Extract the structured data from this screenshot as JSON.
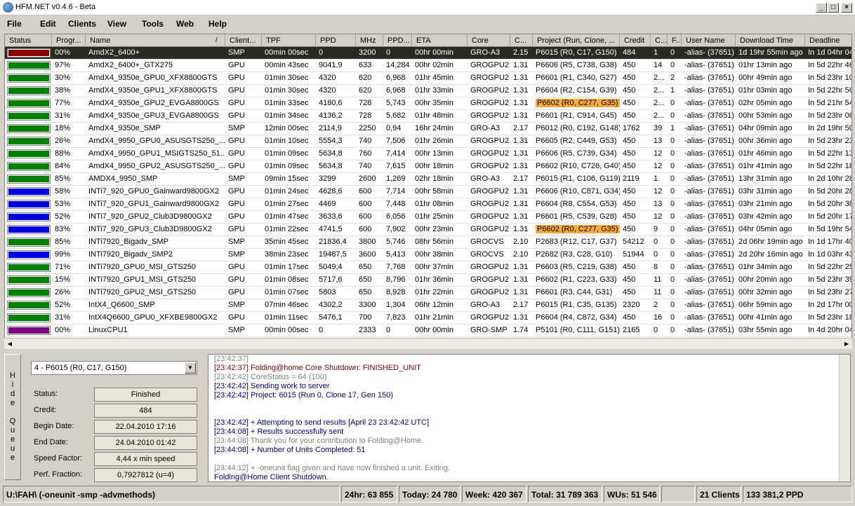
{
  "window": {
    "title": "HFM.NET v0.4.6 - Beta",
    "min": "_",
    "max": "□",
    "close": "×"
  },
  "menu": [
    "File",
    "Edit",
    "Clients",
    "View",
    "Tools",
    "Web",
    "Help"
  ],
  "columns": [
    "Status",
    "Progr...",
    "Name",
    "Client...",
    "TPF",
    "PPD",
    "MHz",
    "PPD...",
    "ETA",
    "Core",
    "C...",
    "Project (Run, Clone, ...",
    "Credit",
    "C...",
    "F...",
    "User Name",
    "Download Time",
    "Deadline"
  ],
  "sort_indicator": "/",
  "colors": {
    "green": "#008000",
    "red": "#8b0000",
    "blue": "#0000e0",
    "purple": "#800080",
    "highlight": "#f9a93a"
  },
  "rows": [
    {
      "status": "red",
      "progress": "00%",
      "name": "AmdX2_6400+",
      "client": "SMP",
      "tpf": "00min 00sec",
      "ppd": "0",
      "mhz": "3200",
      "ppdm": "0",
      "eta": "00hr 00min",
      "core": "GRO-A3",
      "cv": "2.15",
      "project": "P6015 (R0, C17, G150)",
      "credit": "484",
      "c": "1",
      "f": "0",
      "user": "-alias- (37651)",
      "download": "1d 19hr 55min ago",
      "deadline": "In 1d 04hr 04",
      "selected": true
    },
    {
      "status": "green",
      "progress": "97%",
      "name": "AmdX2_6400+_GTX275",
      "client": "GPU",
      "tpf": "00min 43sec",
      "ppd": "9041,9",
      "mhz": "633",
      "ppdm": "14,284",
      "eta": "00hr 02min",
      "core": "GROGPU2",
      "cv": "1.31",
      "project": "P6606 (R5, C738, G38)",
      "credit": "450",
      "c": "14",
      "f": "0",
      "user": "-alias- (37651)",
      "download": "01hr 13min ago",
      "deadline": "In 5d 22hr 46"
    },
    {
      "status": "green",
      "progress": "30%",
      "name": "AmdX4_9350e_GPU0_XFX8800GTS",
      "client": "GPU",
      "tpf": "01min 30sec",
      "ppd": "4320",
      "mhz": "620",
      "ppdm": "6,968",
      "eta": "01hr 45min",
      "core": "GROGPU2",
      "cv": "1.31",
      "project": "P6601 (R1, C340, G27)",
      "credit": "450",
      "c": "2...",
      "f": "2",
      "user": "-alias- (37651)",
      "download": "00hr 49min ago",
      "deadline": "In 5d 23hr 10"
    },
    {
      "status": "green",
      "progress": "38%",
      "name": "AmdX4_9350e_GPU1_XFX8800GTS",
      "client": "GPU",
      "tpf": "01min 30sec",
      "ppd": "4320",
      "mhz": "620",
      "ppdm": "6,968",
      "eta": "01hr 33min",
      "core": "GROGPU2",
      "cv": "1.31",
      "project": "P6604 (R2, C154, G39)",
      "credit": "450",
      "c": "2...",
      "f": "1",
      "user": "-alias- (37651)",
      "download": "01hr 03min ago",
      "deadline": "In 5d 22hr 56"
    },
    {
      "status": "green",
      "progress": "77%",
      "name": "AmdX4_9350e_GPU2_EVGA8800GS",
      "client": "GPU",
      "tpf": "01min 33sec",
      "ppd": "4180,6",
      "mhz": "728",
      "ppdm": "5,743",
      "eta": "00hr 35min",
      "core": "GROGPU2",
      "cv": "1.31",
      "project": "P6602 (R0, C277, G35)",
      "credit": "450",
      "c": "2...",
      "f": "0",
      "user": "-alias- (37651)",
      "download": "02hr 05min ago",
      "deadline": "In 5d 21hr 54",
      "hl": true
    },
    {
      "status": "green",
      "progress": "31%",
      "name": "AmdX4_9350e_GPU3_EVGA8800GS",
      "client": "GPU",
      "tpf": "01min 34sec",
      "ppd": "4136,2",
      "mhz": "728",
      "ppdm": "5,682",
      "eta": "01hr 48min",
      "core": "GROGPU2",
      "cv": "1.31",
      "project": "P6601 (R1, C914, G45)",
      "credit": "450",
      "c": "2...",
      "f": "0",
      "user": "-alias- (37651)",
      "download": "00hr 53min ago",
      "deadline": "In 5d 23hr 06"
    },
    {
      "status": "green",
      "progress": "18%",
      "name": "AmdX4_9350e_SMP",
      "client": "SMP",
      "tpf": "12min 00sec",
      "ppd": "2114,9",
      "mhz": "2250",
      "ppdm": "0,94",
      "eta": "16hr 24min",
      "core": "GRO-A3",
      "cv": "2.17",
      "project": "P6012 (R0, C192, G148)",
      "credit": "1762",
      "c": "39",
      "f": "1",
      "user": "-alias- (37651)",
      "download": "04hr 09min ago",
      "deadline": "In 2d 19hr 50"
    },
    {
      "status": "green",
      "progress": "26%",
      "name": "AmdX4_9950_GPU0_ASUSGTS250_...",
      "client": "GPU",
      "tpf": "01min 10sec",
      "ppd": "5554,3",
      "mhz": "740",
      "ppdm": "7,506",
      "eta": "01hr 26min",
      "core": "GROGPU2",
      "cv": "1.31",
      "project": "P6605 (R2, C449, G53)",
      "credit": "450",
      "c": "13",
      "f": "0",
      "user": "-alias- (37651)",
      "download": "00hr 36min ago",
      "deadline": "In 5d 23hr 23"
    },
    {
      "status": "green",
      "progress": "88%",
      "name": "AmdX4_9950_GPU1_MSIGTS250_51...",
      "client": "GPU",
      "tpf": "01min 09sec",
      "ppd": "5634,8",
      "mhz": "760",
      "ppdm": "7,414",
      "eta": "00hr 13min",
      "core": "GROGPU2",
      "cv": "1.31",
      "project": "P6606 (R5, C739, G34)",
      "credit": "450",
      "c": "12",
      "f": "0",
      "user": "-alias- (37651)",
      "download": "01hr 46min ago",
      "deadline": "In 5d 22hr 13"
    },
    {
      "status": "green",
      "progress": "84%",
      "name": "AmdX4_9950_GPU2_ASUSGTS250_...",
      "client": "GPU",
      "tpf": "01min 09sec",
      "ppd": "5634,8",
      "mhz": "740",
      "ppdm": "7,615",
      "eta": "00hr 18min",
      "core": "GROGPU2",
      "cv": "1.31",
      "project": "P6602 (R10, C726, G40)",
      "credit": "450",
      "c": "12",
      "f": "0",
      "user": "-alias- (37651)",
      "download": "01hr 41min ago",
      "deadline": "In 5d 22hr 18"
    },
    {
      "status": "green",
      "progress": "85%",
      "name": "AMDX4_9950_SMP",
      "client": "SMP",
      "tpf": "09min 15sec",
      "ppd": "3299",
      "mhz": "2600",
      "ppdm": "1,269",
      "eta": "02hr 18min",
      "core": "GRO-A3",
      "cv": "2.17",
      "project": "P6015 (R1, C106, G119)",
      "credit": "2119",
      "c": "1",
      "f": "0",
      "user": "-alias- (37651)",
      "download": "13hr 31min ago",
      "deadline": "In 2d 10hr 28"
    },
    {
      "status": "blue",
      "progress": "58%",
      "name": "INTi7_920_GPU0_Gainward9800GX2",
      "client": "GPU",
      "tpf": "01min 24sec",
      "ppd": "4628,6",
      "mhz": "600",
      "ppdm": "7,714",
      "eta": "00hr 58min",
      "core": "GROGPU2",
      "cv": "1.31",
      "project": "P6606 (R10, C871, G34)",
      "credit": "450",
      "c": "12",
      "f": "0",
      "user": "-alias- (37651)",
      "download": "03hr 31min ago",
      "deadline": "In 5d 20hr 28"
    },
    {
      "status": "blue",
      "progress": "53%",
      "name": "INTi7_920_GPU1_Gainward9800GX2",
      "client": "GPU",
      "tpf": "01min 27sec",
      "ppd": "4469",
      "mhz": "600",
      "ppdm": "7,448",
      "eta": "01hr 08min",
      "core": "GROGPU2",
      "cv": "1.31",
      "project": "P6604 (R8, C554, G53)",
      "credit": "450",
      "c": "13",
      "f": "0",
      "user": "-alias- (37651)",
      "download": "03hr 21min ago",
      "deadline": "In 5d 20hr 38"
    },
    {
      "status": "blue",
      "progress": "52%",
      "name": "INTi7_920_GPU2_Club3D9800GX2",
      "client": "GPU",
      "tpf": "01min 47sec",
      "ppd": "3633,6",
      "mhz": "600",
      "ppdm": "6,056",
      "eta": "01hr 25min",
      "core": "GROGPU2",
      "cv": "1.31",
      "project": "P6601 (R5, C539, G28)",
      "credit": "450",
      "c": "12",
      "f": "0",
      "user": "-alias- (37651)",
      "download": "03hr 42min ago",
      "deadline": "In 5d 20hr 17"
    },
    {
      "status": "blue",
      "progress": "83%",
      "name": "INTi7_920_GPU3_Club3D9800GX2",
      "client": "GPU",
      "tpf": "01min 22sec",
      "ppd": "4741,5",
      "mhz": "600",
      "ppdm": "7,902",
      "eta": "00hr 23min",
      "core": "GROGPU2",
      "cv": "1.31",
      "project": "P6602 (R0, C277, G35)",
      "credit": "450",
      "c": "9",
      "f": "0",
      "user": "-alias- (37651)",
      "download": "04hr 05min ago",
      "deadline": "In 5d 19hr 54",
      "hl": true
    },
    {
      "status": "green",
      "progress": "85%",
      "name": "INTi7920_Bigadv_SMP",
      "client": "SMP",
      "tpf": "35min 45sec",
      "ppd": "21836,4",
      "mhz": "3800",
      "ppdm": "5,746",
      "eta": "08hr 56min",
      "core": "GROCVS",
      "cv": "2.10",
      "project": "P2683 (R12, C17, G37)",
      "credit": "54212",
      "c": "0",
      "f": "0",
      "user": "-alias- (37651)",
      "download": "2d 06hr 19min ago",
      "deadline": "In 1d 17hr 40"
    },
    {
      "status": "blue",
      "progress": "99%",
      "name": "INTi7920_Bigadv_SMP2",
      "client": "SMP",
      "tpf": "38min 23sec",
      "ppd": "19487,5",
      "mhz": "3600",
      "ppdm": "5,413",
      "eta": "00hr 38min",
      "core": "GROCVS",
      "cv": "2.10",
      "project": "P2682 (R3, C28, G10)",
      "credit": "51944",
      "c": "0",
      "f": "0",
      "user": "-alias- (37651)",
      "download": "2d 20hr 16min ago",
      "deadline": "In 1d 03hr 43"
    },
    {
      "status": "green",
      "progress": "71%",
      "name": "INTi7920_GPU0_MSI_GTS250",
      "client": "GPU",
      "tpf": "01min 17sec",
      "ppd": "5049,4",
      "mhz": "650",
      "ppdm": "7,768",
      "eta": "00hr 37min",
      "core": "GROGPU2",
      "cv": "1.31",
      "project": "P6603 (R5, C219, G38)",
      "credit": "450",
      "c": "8",
      "f": "0",
      "user": "-alias- (37651)",
      "download": "01hr 34min ago",
      "deadline": "In 5d 22hr 25"
    },
    {
      "status": "green",
      "progress": "15%",
      "name": "INTi7920_GPU1_MSI_GTS250",
      "client": "GPU",
      "tpf": "01min 08sec",
      "ppd": "5717,6",
      "mhz": "650",
      "ppdm": "8,796",
      "eta": "01hr 36min",
      "core": "GROGPU2",
      "cv": "1.31",
      "project": "P6602 (R1, C223, G33)",
      "credit": "450",
      "c": "11",
      "f": "0",
      "user": "-alias- (37651)",
      "download": "00hr 20min ago",
      "deadline": "In 5d 23hr 39"
    },
    {
      "status": "green",
      "progress": "26%",
      "name": "INTi7920_GPU2_MSI_GTS250",
      "client": "GPU",
      "tpf": "01min 07sec",
      "ppd": "5803",
      "mhz": "650",
      "ppdm": "8,928",
      "eta": "01hr 22min",
      "core": "GROGPU2",
      "cv": "1.31",
      "project": "P6601 (R3, C44, G31)",
      "credit": "450",
      "c": "11",
      "f": "0",
      "user": "-alias- (37651)",
      "download": "00hr 32min ago",
      "deadline": "In 5d 23hr 27"
    },
    {
      "status": "green",
      "progress": "52%",
      "name": "IntX4_Q6600_SMP",
      "client": "SMP",
      "tpf": "07min 46sec",
      "ppd": "4302,2",
      "mhz": "3300",
      "ppdm": "1,304",
      "eta": "06hr 12min",
      "core": "GRO-A3",
      "cv": "2.17",
      "project": "P6015 (R1, C35, G135)",
      "credit": "2320",
      "c": "2",
      "f": "0",
      "user": "-alias- (37651)",
      "download": "06hr 59min ago",
      "deadline": "In 2d 17hr 00"
    },
    {
      "status": "green",
      "progress": "31%",
      "name": "IntX4Q6600_GPU0_XFXBE9800GX2",
      "client": "GPU",
      "tpf": "01min 11sec",
      "ppd": "5476,1",
      "mhz": "700",
      "ppdm": "7,823",
      "eta": "01hr 21min",
      "core": "GROGPU2",
      "cv": "1.31",
      "project": "P6604 (R4, C872, G34)",
      "credit": "450",
      "c": "16",
      "f": "0",
      "user": "-alias- (37651)",
      "download": "00hr 41min ago",
      "deadline": "In 5d 23hr 18"
    },
    {
      "status": "purple",
      "progress": "00%",
      "name": "LinuxCPU1",
      "client": "SMP",
      "tpf": "00min 00sec",
      "ppd": "0",
      "mhz": "2333",
      "ppdm": "0",
      "eta": "00hr 00min",
      "core": "GRO-SMP",
      "cv": "1.74",
      "project": "P5101 (R0, C111, G151)",
      "credit": "2165",
      "c": "0",
      "f": "0",
      "user": "-alias- (37651)",
      "download": "03hr 55min ago",
      "deadline": "In 4d 20hr 04"
    }
  ],
  "queue": {
    "hide_label": "Hide Queue",
    "selected": "4 - P6015 (R0, C17, G150)",
    "fields": [
      {
        "label": "Status:",
        "value": "Finished"
      },
      {
        "label": "Credit:",
        "value": "484"
      },
      {
        "label": "Begin Date:",
        "value": "22.04.2010 17:16"
      },
      {
        "label": "End Date:",
        "value": "24.04.2010 01:42"
      },
      {
        "label": "Speed Factor:",
        "value": "4,44 x min speed"
      },
      {
        "label": "Perf. Fraction:",
        "value": "0,7927812 (u=4)"
      }
    ]
  },
  "log": [
    {
      "text": "[23:42:37]",
      "color": "#808080"
    },
    {
      "text": "[23:42:37] Folding@home Core Shutdown: FINISHED_UNIT",
      "color": "#8b0000"
    },
    {
      "text": "[23:42:42] CoreStatus = 64 (100)",
      "color": "#808080"
    },
    {
      "text": "[23:42:42] Sending work to server",
      "color": "#000080"
    },
    {
      "text": "[23:42:42] Project: 6015 (Run 0, Clone 17, Gen 150)",
      "color": "#000080"
    },
    {
      "text": "",
      "color": "#000"
    },
    {
      "text": "",
      "color": "#000"
    },
    {
      "text": "[23:42:42] + Attempting to send results [April 23 23:42:42 UTC]",
      "color": "#000080"
    },
    {
      "text": "[23:44:08] + Results successfully sent",
      "color": "#000080"
    },
    {
      "text": "[23:44:08] Thank you for your contribution to Folding@Home.",
      "color": "#808080"
    },
    {
      "text": "[23:44:08] + Number of Units Completed: 51",
      "color": "#000080"
    },
    {
      "text": "",
      "color": "#000"
    },
    {
      "text": "[23:44:12] + -oneunit flag given and have now finished a unit. Exiting.",
      "color": "#808080"
    },
    {
      "text": "Folding@Home Client Shutdown.",
      "color": "#000080"
    }
  ],
  "statusbar": {
    "path": "U:\\FAH\\ (-oneunit -smp -advmethods)",
    "h24": "24hr: 63 855",
    "today": "Today: 24 780",
    "week": "Week: 420 367",
    "total": "Total: 31 789 363",
    "wus": "WUs: 51 546",
    "clients": "21 Clients",
    "ppd": "133 381,2 PPD"
  }
}
